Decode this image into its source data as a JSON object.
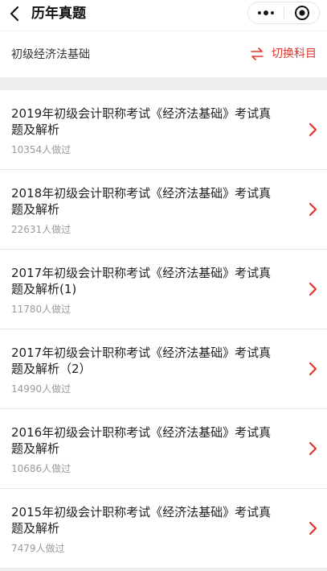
{
  "nav": {
    "title": "历年真题",
    "icons": {
      "back": "chevron-left-icon",
      "more": "more-dots-icon",
      "close": "record-circle-icon"
    }
  },
  "subject": {
    "name": "初级经济法基础",
    "switch_label": "切换科目",
    "switch_icon": "swap-arrows-icon"
  },
  "colors": {
    "accent": "#e3352b",
    "muted": "#9a9a9a",
    "divider_bg": "#efefef"
  },
  "list": {
    "items": [
      {
        "title": "2019年初级会计职称考试《经济法基础》考试真题及解析",
        "count": "10354人做过"
      },
      {
        "title": "2018年初级会计职称考试《经济法基础》考试真题及解析",
        "count": "22631人做过"
      },
      {
        "title": "2017年初级会计职称考试《经济法基础》考试真题及解析(1)",
        "count": "11780人做过"
      },
      {
        "title": "2017年初级会计职称考试《经济法基础》考试真题及解析（2）",
        "count": "14990人做过"
      },
      {
        "title": "2016年初级会计职称考试《经济法基础》考试真题及解析",
        "count": "10686人做过"
      },
      {
        "title": "2015年初级会计职称考试《经济法基础》考试真题及解析",
        "count": "7479人做过"
      }
    ]
  }
}
